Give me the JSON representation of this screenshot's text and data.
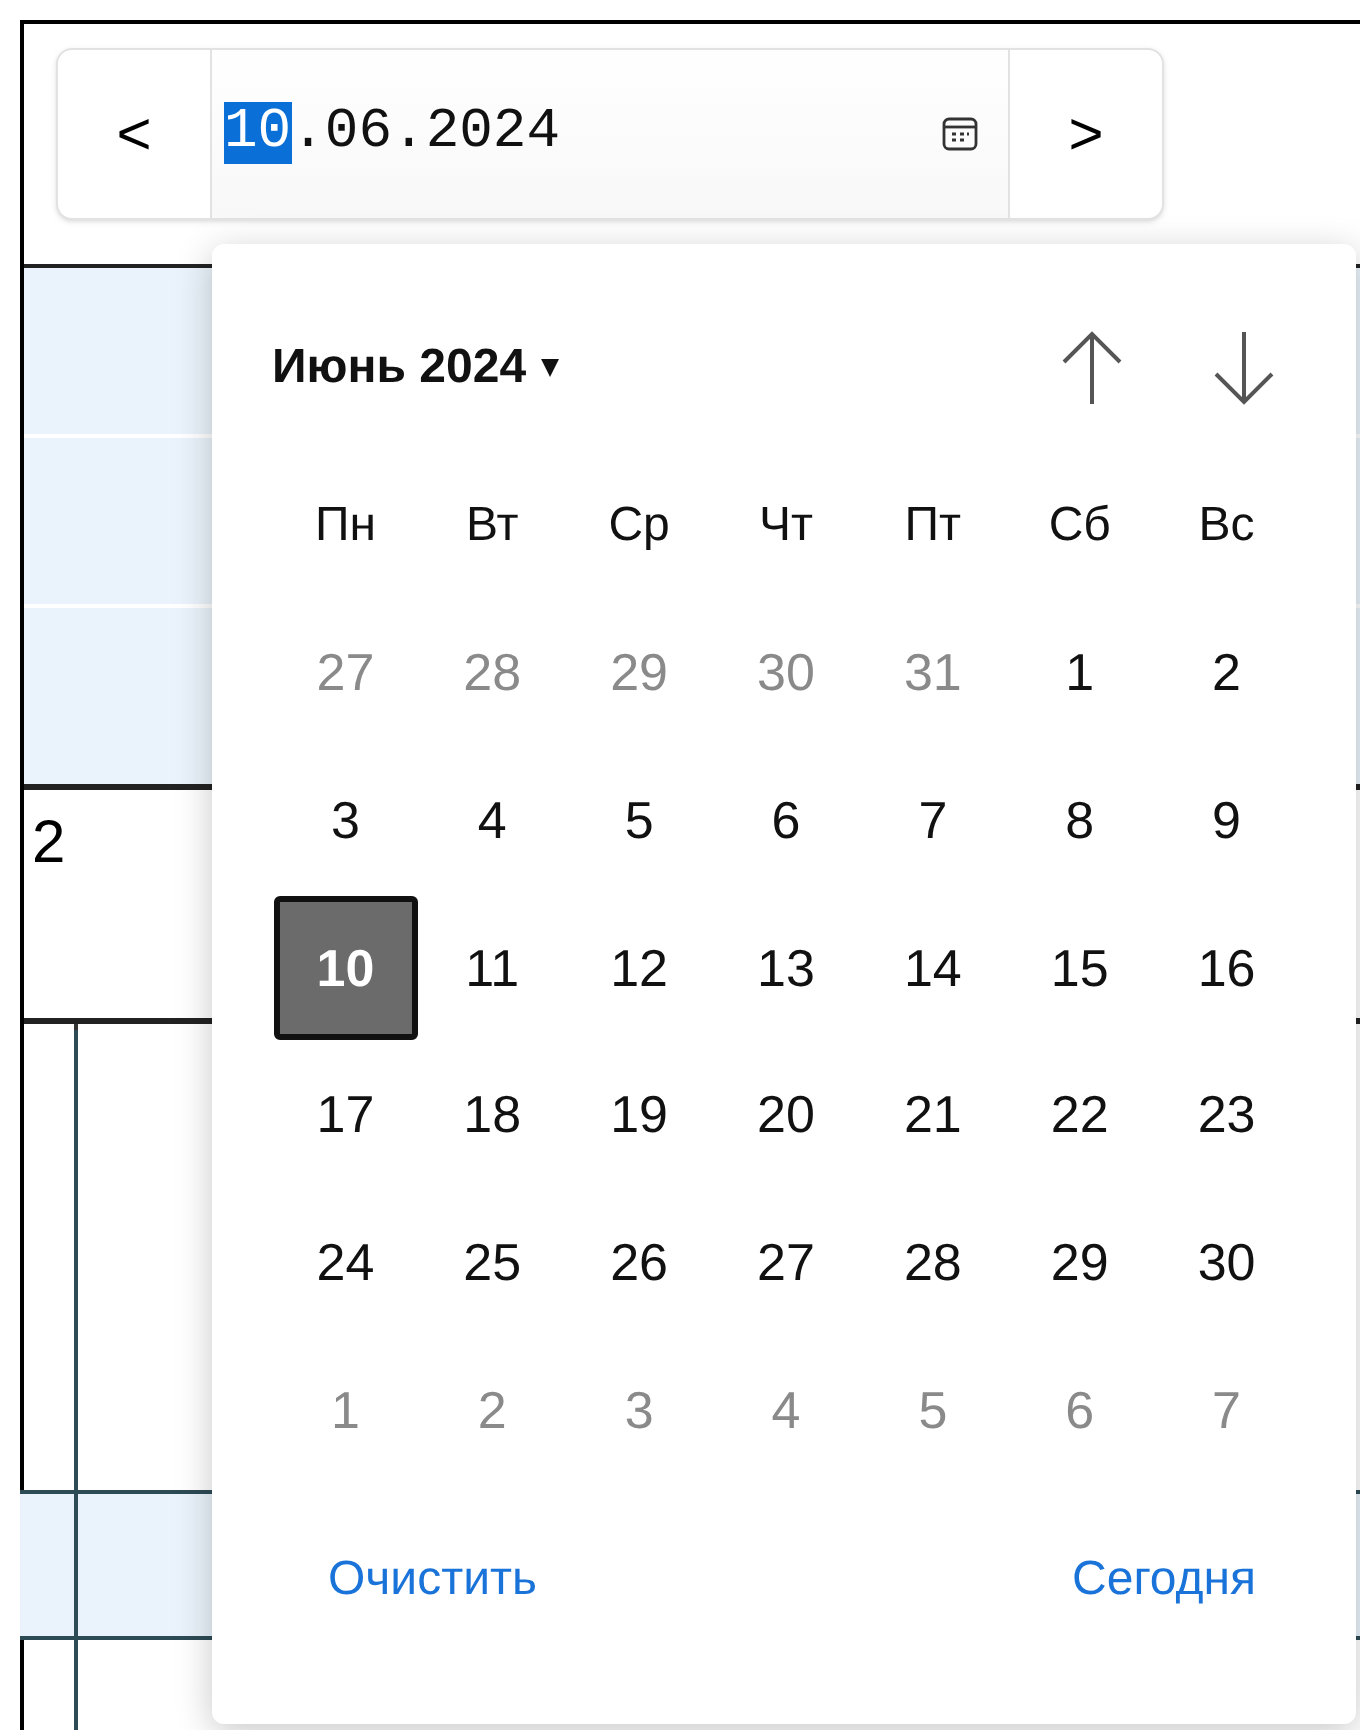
{
  "date_picker": {
    "prev_button": "<",
    "next_button": ">",
    "segments": [
      {
        "text": "10",
        "selected": true
      },
      {
        "text": ".06.2024",
        "selected": false
      }
    ]
  },
  "background_table": {
    "cell_text": "2"
  },
  "calendar": {
    "month_label": "Июнь 2024",
    "month_caret": "▾",
    "weekdays": [
      "Пн",
      "Вт",
      "Ср",
      "Чт",
      "Пт",
      "Сб",
      "Вс"
    ],
    "weeks": [
      [
        {
          "day": "27",
          "muted": true,
          "selected": false
        },
        {
          "day": "28",
          "muted": true,
          "selected": false
        },
        {
          "day": "29",
          "muted": true,
          "selected": false
        },
        {
          "day": "30",
          "muted": true,
          "selected": false
        },
        {
          "day": "31",
          "muted": true,
          "selected": false
        },
        {
          "day": "1",
          "muted": false,
          "selected": false
        },
        {
          "day": "2",
          "muted": false,
          "selected": false
        }
      ],
      [
        {
          "day": "3",
          "muted": false,
          "selected": false
        },
        {
          "day": "4",
          "muted": false,
          "selected": false
        },
        {
          "day": "5",
          "muted": false,
          "selected": false
        },
        {
          "day": "6",
          "muted": false,
          "selected": false
        },
        {
          "day": "7",
          "muted": false,
          "selected": false
        },
        {
          "day": "8",
          "muted": false,
          "selected": false
        },
        {
          "day": "9",
          "muted": false,
          "selected": false
        }
      ],
      [
        {
          "day": "10",
          "muted": false,
          "selected": true
        },
        {
          "day": "11",
          "muted": false,
          "selected": false
        },
        {
          "day": "12",
          "muted": false,
          "selected": false
        },
        {
          "day": "13",
          "muted": false,
          "selected": false
        },
        {
          "day": "14",
          "muted": false,
          "selected": false
        },
        {
          "day": "15",
          "muted": false,
          "selected": false
        },
        {
          "day": "16",
          "muted": false,
          "selected": false
        }
      ],
      [
        {
          "day": "17",
          "muted": false,
          "selected": false
        },
        {
          "day": "18",
          "muted": false,
          "selected": false
        },
        {
          "day": "19",
          "muted": false,
          "selected": false
        },
        {
          "day": "20",
          "muted": false,
          "selected": false
        },
        {
          "day": "21",
          "muted": false,
          "selected": false
        },
        {
          "day": "22",
          "muted": false,
          "selected": false
        },
        {
          "day": "23",
          "muted": false,
          "selected": false
        }
      ],
      [
        {
          "day": "24",
          "muted": false,
          "selected": false
        },
        {
          "day": "25",
          "muted": false,
          "selected": false
        },
        {
          "day": "26",
          "muted": false,
          "selected": false
        },
        {
          "day": "27",
          "muted": false,
          "selected": false
        },
        {
          "day": "28",
          "muted": false,
          "selected": false
        },
        {
          "day": "29",
          "muted": false,
          "selected": false
        },
        {
          "day": "30",
          "muted": false,
          "selected": false
        }
      ],
      [
        {
          "day": "1",
          "muted": true,
          "selected": false
        },
        {
          "day": "2",
          "muted": true,
          "selected": false
        },
        {
          "day": "3",
          "muted": true,
          "selected": false
        },
        {
          "day": "4",
          "muted": true,
          "selected": false
        },
        {
          "day": "5",
          "muted": true,
          "selected": false
        },
        {
          "day": "6",
          "muted": true,
          "selected": false
        },
        {
          "day": "7",
          "muted": true,
          "selected": false
        }
      ]
    ],
    "clear_link": "Очистить",
    "today_link": "Сегодня"
  }
}
